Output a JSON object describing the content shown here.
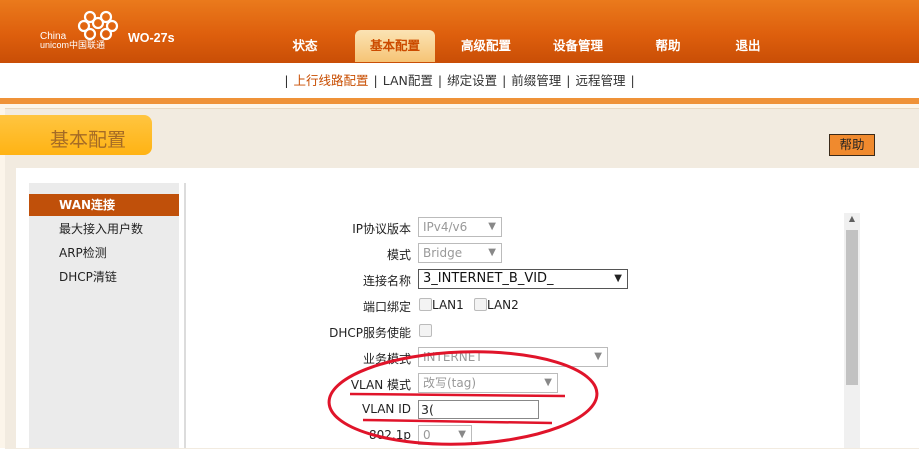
{
  "header": {
    "logo_line1": "China",
    "logo_line2": "unicom中国联通",
    "model": "WO-27s",
    "nav": [
      "状态",
      "基本配置",
      "高级配置",
      "设备管理",
      "帮助",
      "退出"
    ]
  },
  "subnav": [
    "上行线路配置",
    "LAN配置",
    "绑定设置",
    "前缀管理",
    "远程管理"
  ],
  "page_title": "基本配置",
  "help_label": "帮助",
  "sidebar": [
    "WAN连接",
    "最大接入用户数",
    "ARP检测",
    "DHCP清链"
  ],
  "form": {
    "ip_version_label": "IP协议版本",
    "ip_version_value": "IPv4/v6",
    "mode_label": "模式",
    "mode_value": "Bridge",
    "conn_name_label": "连接名称",
    "conn_name_value": "3_INTERNET_B_VID_",
    "port_bind_label": "端口绑定",
    "lan1": "LAN1",
    "lan2": "LAN2",
    "dhcp_label": "DHCP服务使能",
    "service_mode_label": "业务模式",
    "service_mode_value": "INTERNET",
    "vlan_mode_label": "VLAN 模式",
    "vlan_mode_value": "改写(tag)",
    "vlan_id_label": "VLAN ID",
    "vlan_id_value": "3(",
    "dot1p_label": "802.1p",
    "dot1p_value": "0"
  },
  "colors": {
    "brand_orange": "#de5f0d",
    "annotation_red": "#e0142a",
    "active_menu": "#c0500a"
  }
}
